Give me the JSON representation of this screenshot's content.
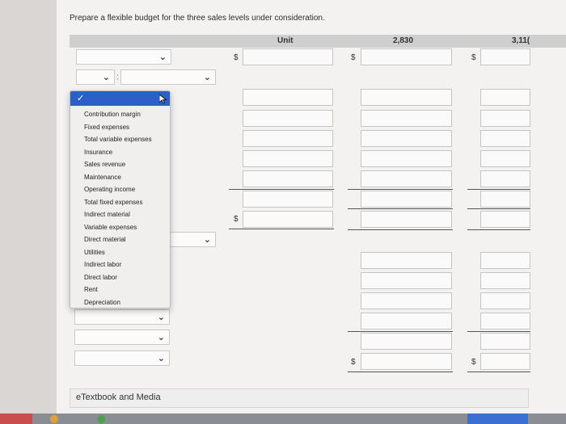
{
  "instruction": "Prepare a flexible budget for the three sales levels under consideration.",
  "columns": [
    "Unit",
    "2,830",
    "3,11("
  ],
  "currency_symbol": "$",
  "dropdown": {
    "options": [
      "Contribution margin",
      "Fixed expenses",
      "Total variable expenses",
      "Insurance",
      "Sales revenue",
      "Maintenance",
      "Operating income",
      "Total fixed expenses",
      "Indirect material",
      "Variable expenses",
      "Direct material",
      "Utilities",
      "Indirect labor",
      "Direct labor",
      "Rent",
      "Depreciation"
    ]
  },
  "footer_link": "eTextbook and Media",
  "colors": {
    "selected": "#2d5fc9",
    "header_bar": "#cfcfcf"
  },
  "icons": [
    "chevron-down-icon",
    "check-icon",
    "cursor-icon"
  ]
}
